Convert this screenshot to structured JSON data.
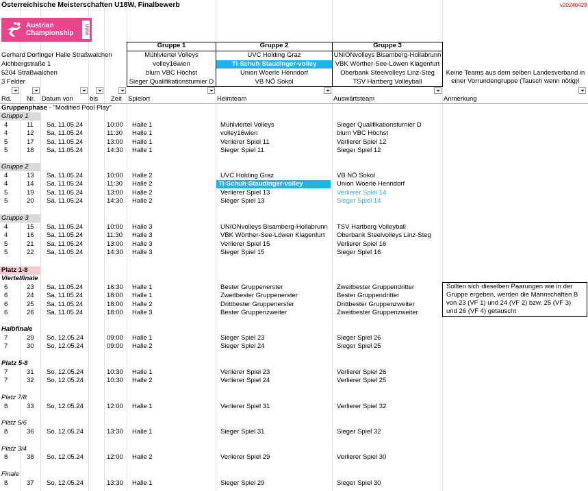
{
  "title": "Österreichische Meisterschaften U18W, Finalbewerb",
  "version": "v20240429",
  "logo": {
    "line1": "Austrian",
    "line2": "Championship",
    "vertical": "U18W"
  },
  "venue": {
    "hall": "Gerhard Dorfinger Halle Straßwalchen",
    "street": "Aichbergstraße 1",
    "city": "5204 Straßwalchen",
    "fields": "3 Felder"
  },
  "groups": [
    {
      "header": "Gruppe 1",
      "teams": [
        "Mühlviertel Volleys",
        "volley16wien",
        "blum VBC Höchst",
        "Sieger Qualifikationsturnier D"
      ]
    },
    {
      "header": "Gruppe 2",
      "teams": [
        "UVC Holding Graz",
        "TI-Schuh-Staudinger-volley",
        "Union Woerle Henndorf",
        "VB NÖ Sokol"
      ]
    },
    {
      "header": "Gruppe 3",
      "teams": [
        "UNIONvolleys Bisamberg-Hollabrunn",
        "VBK Wörther-See-Löwen Klagenfurt",
        "Oberbank Steelvolleys Linz-Steg",
        "TSV Hartberg Volleyball"
      ]
    }
  ],
  "group_note": "Keine Teams aus dem selben Landesverband in einer Vorrundengruppe (Tausch wenn nötig)!",
  "columns": {
    "rd": "Rd.",
    "nr": "Nr.",
    "datum": "Datum von",
    "bis": "bis",
    "zeit": "Zeit",
    "spielort": "Spielort",
    "heim": "Heimteam",
    "aus": "Auswärtsteam",
    "anm": "Anmerkung"
  },
  "phase": {
    "label": "Gruppenphase",
    "sub": " - \"Modified Pool Play\""
  },
  "sections": [
    {
      "label": "Gruppe 1",
      "rows": [
        [
          "4",
          "11",
          "Sa, 11.05.24",
          "10:00",
          "Halle 1",
          "Mühlviertel Volleys",
          "Sieger Qualifikationsturnier D"
        ],
        [
          "4",
          "12",
          "Sa, 11.05.24",
          "11:30",
          "Halle 1",
          "volley16wien",
          "blum VBC Höchst"
        ],
        [
          "5",
          "17",
          "Sa, 11.05.24",
          "13:00",
          "Halle 1",
          "Verlierer Spiel 11",
          "Verlierer Spiel 12"
        ],
        [
          "5",
          "18",
          "Sa, 11.05.24",
          "14:30",
          "Halle 1",
          "Sieger Spiel 11",
          "Sieger Spiel 12"
        ]
      ]
    },
    {
      "label": "Gruppe 2",
      "rows": [
        [
          "4",
          "13",
          "Sa, 11.05.24",
          "10:00",
          "Halle 2",
          "UVC Holding Graz",
          "VB NÖ Sokol"
        ],
        [
          "4",
          "14",
          "Sa, 11.05.24",
          "11:30",
          "Halle 2",
          "TI-Schuh-Staudinger-volley",
          "Union Woerle Henndorf"
        ],
        [
          "5",
          "19",
          "Sa, 11.05.24",
          "13:00",
          "Halle 2",
          "Verlierer Spiel 13",
          "Verlierer Spiel 14"
        ],
        [
          "5",
          "20",
          "Sa, 11.05.24",
          "14:30",
          "Halle 2",
          "Sieger Spiel 13",
          "Sieger Spiel 14"
        ]
      ]
    },
    {
      "label": "Gruppe 3",
      "rows": [
        [
          "4",
          "15",
          "Sa, 11.05.24",
          "10:00",
          "Halle 3",
          "UNIONvolleys Bisamberg-Hollabrunn",
          "TSV Hartberg Volleyball"
        ],
        [
          "4",
          "16",
          "Sa, 11.05.24",
          "11:30",
          "Halle 3",
          "VBK Wörther-See-Löwen Klagenfurt",
          "Oberbank Steelvolleys Linz-Steg"
        ],
        [
          "5",
          "21",
          "Sa, 11.05.24",
          "13:00",
          "Halle 3",
          "Verlierer Spiel 15",
          "Verlierer Spiel 16"
        ],
        [
          "5",
          "22",
          "Sa, 11.05.24",
          "14:30",
          "Halle 3",
          "Sieger Spiel 15",
          "Sieger Spiel 16"
        ]
      ]
    }
  ],
  "platz18": "Platz 1-8",
  "viertelfinale": {
    "label": "Viertelfinale",
    "rows": [
      [
        "6",
        "23",
        "Sa, 11.05.24",
        "16:30",
        "Halle 1",
        "Bester Gruppenerster",
        "Zweitbester Gruppendritter"
      ],
      [
        "6",
        "24",
        "Sa, 11.05.24",
        "18:00",
        "Halle 1",
        "Zweitbester Gruppenerster",
        "Bester Gruppendritter"
      ],
      [
        "6",
        "25",
        "Sa, 11.05.24",
        "18:00",
        "Halle 2",
        "Drittbester Gruppenerster",
        "Drittbester Gruppenzweiter"
      ],
      [
        "6",
        "26",
        "Sa, 11.05.24",
        "18:00",
        "Halle 3",
        "Bester Gruppenzweiter",
        "Zweitbester Gruppenzweiter"
      ]
    ],
    "note": [
      "Sollten sich dieselben Paarungen wie in der",
      "Gruppe ergeben, werden die Mannschaften B",
      "von 23 (VF 1) und 24 (VF 2) bzw. 25 (VF 3)",
      "und 26 (VF 4) getauscht"
    ]
  },
  "halbfinale": {
    "label": "Halbfinale",
    "rows": [
      [
        "7",
        "29",
        "So, 12.05.24",
        "09:00",
        "Halle 1",
        "Sieger Spiel 23",
        "Sieger Spiel 26"
      ],
      [
        "7",
        "30",
        "So, 12.05.24",
        "09:00",
        "Halle 2",
        "Sieger Spiel 24",
        "Sieger Spiel 25"
      ]
    ]
  },
  "platz58": {
    "label": "Platz 5-8",
    "rows": [
      [
        "7",
        "31",
        "So, 12.05.24",
        "10:30",
        "Halle 1",
        "Verlierer Spiel 23",
        "Verlierer Spiel 26"
      ],
      [
        "7",
        "32",
        "So, 12.05.24",
        "10:30",
        "Halle 2",
        "Verlierer Spiel 24",
        "Verlierer Spiel 25"
      ]
    ]
  },
  "platz78": {
    "label": "Platz 7/8",
    "rows": [
      [
        "8",
        "33",
        "So, 12.05.24",
        "12:00",
        "Halle 1",
        "Verlierer Spiel 31",
        "Verlierer Spiel 32"
      ]
    ]
  },
  "platz56": {
    "label": "Platz 5/6",
    "rows": [
      [
        "8",
        "36",
        "So, 12.05.24",
        "13:30",
        "Halle 1",
        "Sieger Spiel 31",
        "Sieger Spiel 32"
      ]
    ]
  },
  "platz34": {
    "label": "Platz 3/4",
    "rows": [
      [
        "8",
        "38",
        "So, 12.05.24",
        "12:00",
        "Halle 2",
        "Verlierer Spiel 29",
        "Verlierer Spiel 30"
      ]
    ]
  },
  "finale": {
    "label": "Finale",
    "rows": [
      [
        "8",
        "37",
        "So, 12.05.24",
        "13:30",
        "Halle 1",
        "Sieger Spiel 29",
        "Sieger Spiel 30"
      ]
    ]
  }
}
